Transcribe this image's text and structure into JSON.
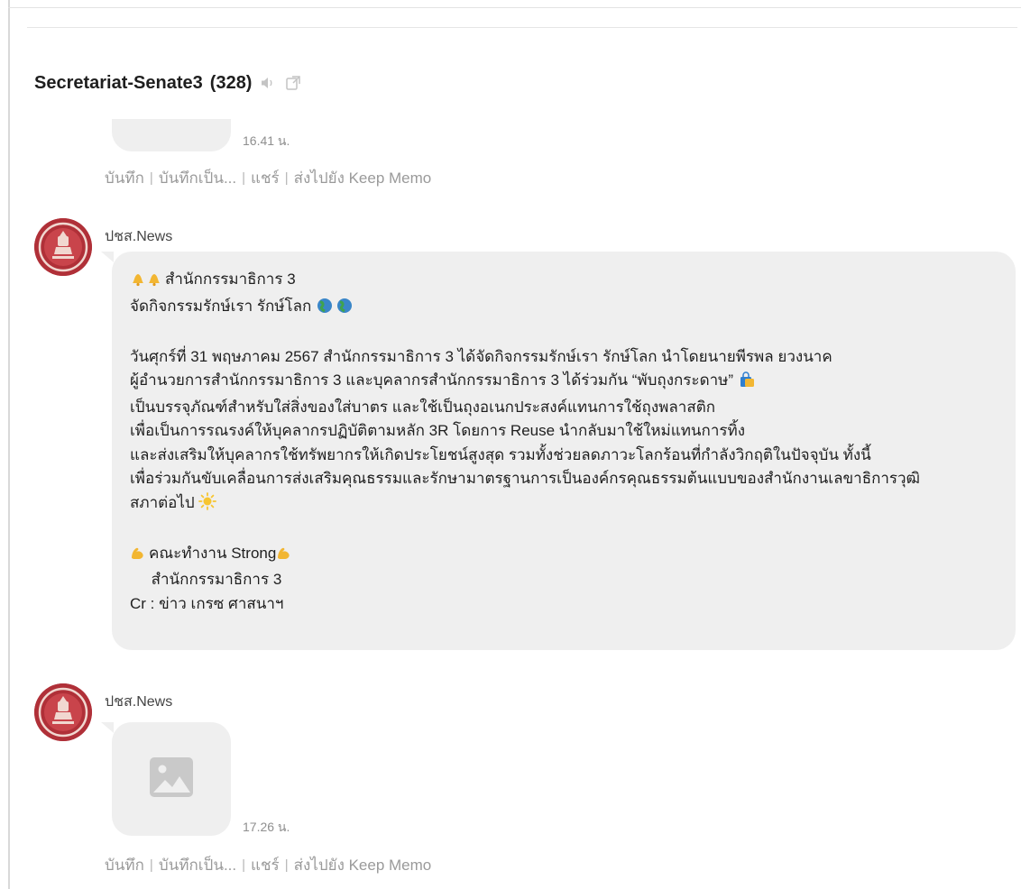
{
  "chat": {
    "title": "Secretariat-Senate3",
    "member_count": "(328)"
  },
  "icons": {
    "mute": "speaker-icon",
    "popout": "popout-icon",
    "avatar": "senate-seal-icon",
    "image_placeholder": "image-placeholder-icon"
  },
  "colors": {
    "bubble": "#efefef",
    "avatar": "#b03038",
    "meta_text": "#9a9a9a"
  },
  "messages": [
    {
      "time": "16.41 น.",
      "actions": [
        "บันทึก",
        "บันทึกเป็น...",
        "แชร์",
        "ส่งไปยัง Keep Memo"
      ]
    },
    {
      "sender": "ปชส.News",
      "lines": [
        "สำนักกรรมาธิการ 3",
        "จัดกิจกรรมรักษ์เรา รักษ์โลก",
        "",
        "วันศุกร์ที่ 31 พฤษภาคม 2567 สำนักกรรมาธิการ 3 ได้จัดกิจกรรมรักษ์เรา รักษ์โลก นำโดยนายพีรพล  ยวงนาค",
        "ผู้อำนวยการสำนักกรรมาธิการ 3 และบุคลากรสำนักกรรมาธิการ 3 ได้ร่วมกัน “พับถุงกระดาษ”",
        "เป็นบรรจุภัณฑ์สำหรับใส่สิ่งของใส่บาตร และใช้เป็นถุงอเนกประสงค์แทนการใช้ถุงพลาสติก",
        "เพื่อเป็นการรณรงค์ให้บุคลากรปฏิบัติตามหลัก 3R โดยการ Reuse นำกลับมาใช้ใหม่แทนการทิ้ง",
        "และส่งเสริมให้บุคลากรใช้ทรัพยากรให้เกิดประโยชน์สูงสุด รวมทั้งช่วยลดภาวะโลกร้อนที่กำลังวิกฤติในปัจจุบัน ทั้งนี้",
        "เพื่อร่วมกันขับเคลื่อนการส่งเสริมคุณธรรมและรักษามาตรฐานการเป็นองค์กรคุณธรรมต้นแบบของสำนักงานเลขาธิการวุฒิ",
        "สภาต่อไป",
        "",
        "คณะทำงาน Strong",
        "     สำนักกรรมาธิการ 3",
        "Cr : ข่าว เกรซ ศาสนาฯ"
      ]
    },
    {
      "sender": "ปชส.News",
      "time": "17.26 น.",
      "actions": [
        "บันทึก",
        "บันทึกเป็น...",
        "แชร์",
        "ส่งไปยัง Keep Memo"
      ]
    }
  ]
}
